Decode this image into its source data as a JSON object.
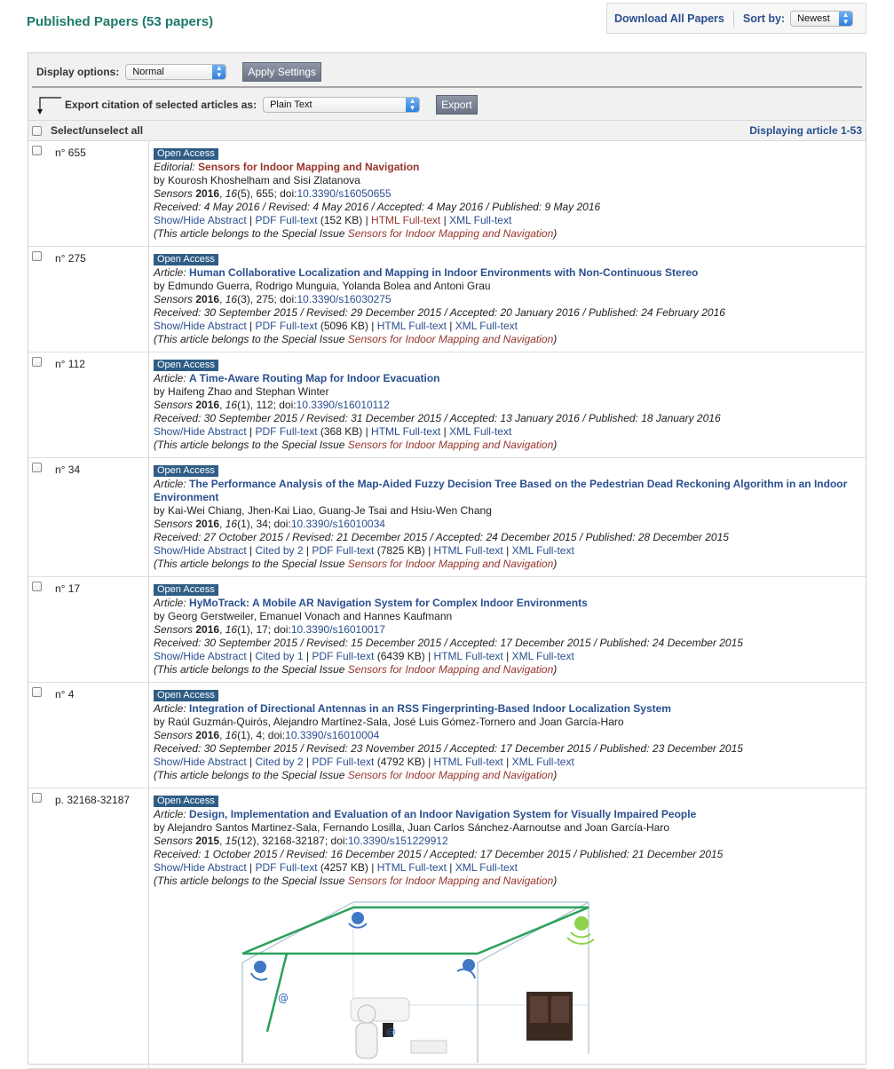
{
  "header": {
    "title": "Published Papers (53 papers)",
    "download_label": "Download All Papers",
    "sort_label": "Sort by:",
    "sort_value": "Newest"
  },
  "toolbar": {
    "display_label": "Display options:",
    "display_value": "Normal",
    "apply_label": "Apply Settings",
    "export_label": "Export citation of selected articles as:",
    "export_format": "Plain Text",
    "export_button": "Export",
    "select_all_label": "Select/unselect all",
    "displaying": "Displaying article 1-53"
  },
  "articles": [
    {
      "num": "n° 655",
      "badge": "Open Access",
      "kind": "Editorial:",
      "title": "Sensors for Indoor Mapping and Navigation",
      "authors": "by Kourosh Khoshelham and Sisi Zlatanova",
      "journal": "Sensors",
      "year": "2016",
      "volume": "16",
      "issue_pages": "(5), 655; doi:",
      "doi": "10.3390/s16050655",
      "dates": "Received: 4 May 2016 / Revised: 4 May 2016 / Accepted: 4 May 2016 / Published: 9 May 2016",
      "abstract": "Show/Hide Abstract",
      "cited": "",
      "pdf": "PDF Full-text",
      "pdf_size": "(152 KB)",
      "html": "HTML Full-text",
      "xml": "XML Full-text",
      "special_prefix": "(This article belongs to the Special Issue",
      "special_issue": "Sensors for Indoor Mapping and Navigation",
      "special_suffix": ")"
    },
    {
      "num": "n° 275",
      "badge": "Open Access",
      "kind": "Article:",
      "title": "Human Collaborative Localization and Mapping in Indoor Environments with Non-Continuous Stereo",
      "authors": "by Edmundo Guerra, Rodrigo Munguia, Yolanda Bolea and Antoni Grau",
      "journal": "Sensors",
      "year": "2016",
      "volume": "16",
      "issue_pages": "(3), 275; doi:",
      "doi": "10.3390/s16030275",
      "dates": "Received: 30 September 2015 / Revised: 29 December 2015 / Accepted: 20 January 2016 / Published: 24 February 2016",
      "abstract": "Show/Hide Abstract",
      "cited": "",
      "pdf": "PDF Full-text",
      "pdf_size": "(5096 KB)",
      "html": "HTML Full-text",
      "xml": "XML Full-text",
      "special_prefix": "(This article belongs to the Special Issue",
      "special_issue": "Sensors for Indoor Mapping and Navigation",
      "special_suffix": ")"
    },
    {
      "num": "n° 112",
      "badge": "Open Access",
      "kind": "Article:",
      "title": "A Time-Aware Routing Map for Indoor Evacuation",
      "authors": "by Haifeng Zhao and Stephan Winter",
      "journal": "Sensors",
      "year": "2016",
      "volume": "16",
      "issue_pages": "(1), 112; doi:",
      "doi": "10.3390/s16010112",
      "dates": "Received: 30 September 2015 / Revised: 31 December 2015 / Accepted: 13 January 2016 / Published: 18 January 2016",
      "abstract": "Show/Hide Abstract",
      "cited": "",
      "pdf": "PDF Full-text",
      "pdf_size": "(368 KB)",
      "html": "HTML Full-text",
      "xml": "XML Full-text",
      "special_prefix": "(This article belongs to the Special Issue",
      "special_issue": "Sensors for Indoor Mapping and Navigation",
      "special_suffix": ")"
    },
    {
      "num": "n° 34",
      "badge": "Open Access",
      "kind": "Article:",
      "title": "The Performance Analysis of the Map-Aided Fuzzy Decision Tree Based on the Pedestrian Dead Reckoning Algorithm in an Indoor Environment",
      "authors": "by Kai-Wei Chiang, Jhen-Kai Liao, Guang-Je Tsai and Hsiu-Wen Chang",
      "journal": "Sensors",
      "year": "2016",
      "volume": "16",
      "issue_pages": "(1), 34; doi:",
      "doi": "10.3390/s16010034",
      "dates": "Received: 27 October 2015 / Revised: 21 December 2015 / Accepted: 24 December 2015 / Published: 28 December 2015",
      "abstract": "Show/Hide Abstract",
      "cited": "Cited by 2",
      "pdf": "PDF Full-text",
      "pdf_size": "(7825 KB)",
      "html": "HTML Full-text",
      "xml": "XML Full-text",
      "special_prefix": "(This article belongs to the Special Issue",
      "special_issue": "Sensors for Indoor Mapping and Navigation",
      "special_suffix": ")"
    },
    {
      "num": "n° 17",
      "badge": "Open Access",
      "kind": "Article:",
      "title": "HyMoTrack: A Mobile AR Navigation System for Complex Indoor Environments",
      "authors": "by Georg Gerstweiler, Emanuel Vonach and Hannes Kaufmann",
      "journal": "Sensors",
      "year": "2016",
      "volume": "16",
      "issue_pages": "(1), 17; doi:",
      "doi": "10.3390/s16010017",
      "dates": "Received: 30 September 2015 / Revised: 15 December 2015 / Accepted: 17 December 2015 / Published: 24 December 2015",
      "abstract": "Show/Hide Abstract",
      "cited": "Cited by 1",
      "pdf": "PDF Full-text",
      "pdf_size": "(6439 KB)",
      "html": "HTML Full-text",
      "xml": "XML Full-text",
      "special_prefix": "(This article belongs to the Special Issue",
      "special_issue": "Sensors for Indoor Mapping and Navigation",
      "special_suffix": ")"
    },
    {
      "num": "n° 4",
      "badge": "Open Access",
      "kind": "Article:",
      "title": "Integration of Directional Antennas in an RSS Fingerprinting-Based Indoor Localization System",
      "authors": "by Raúl Guzmán-Quirós, Alejandro Martínez-Sala, José Luis Gómez-Tornero and Joan García-Haro",
      "journal": "Sensors",
      "year": "2016",
      "volume": "16",
      "issue_pages": "(1), 4; doi:",
      "doi": "10.3390/s16010004",
      "dates": "Received: 30 September 2015 / Revised: 23 November 2015 / Accepted: 17 December 2015 / Published: 23 December 2015",
      "abstract": "Show/Hide Abstract",
      "cited": "Cited by 2",
      "pdf": "PDF Full-text",
      "pdf_size": "(4792 KB)",
      "html": "HTML Full-text",
      "xml": "XML Full-text",
      "special_prefix": "(This article belongs to the Special Issue",
      "special_issue": "Sensors for Indoor Mapping and Navigation",
      "special_suffix": ")"
    },
    {
      "num": "p. 32168-32187",
      "badge": "Open Access",
      "kind": "Article:",
      "title": "Design, Implementation and Evaluation of an Indoor Navigation System for Visually Impaired People",
      "authors": "by Alejandro Santos Martinez-Sala, Fernando Losilla, Juan Carlos Sánchez-Aarnoutse and Joan García-Haro",
      "journal": "Sensors",
      "year": "2015",
      "volume": "15",
      "issue_pages": "(12), 32168-32187; doi:",
      "doi": "10.3390/s151229912",
      "dates": "Received: 1 October 2015 / Revised: 16 December 2015 / Accepted: 17 December 2015 / Published: 21 December 2015",
      "abstract": "Show/Hide Abstract",
      "cited": "",
      "pdf": "PDF Full-text",
      "pdf_size": "(4257 KB)",
      "html": "HTML Full-text",
      "xml": "XML Full-text",
      "special_prefix": "(This article belongs to the Special Issue",
      "special_issue": "Sensors for Indoor Mapping and Navigation",
      "special_suffix": ")",
      "graphic_label": "@"
    }
  ],
  "colors": {
    "title_teal": "#1d7a6b",
    "link_blue": "#2a4f8f",
    "special_red": "#96362c",
    "badge_blue": "#2f5d85"
  }
}
